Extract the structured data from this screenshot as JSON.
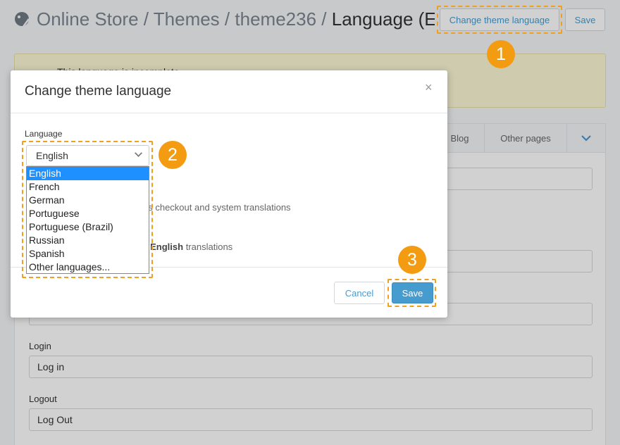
{
  "header": {
    "breadcrumb": [
      "Online Store",
      "Themes",
      "theme236"
    ],
    "separator": "/",
    "current": "Language (En…",
    "change_language_label": "Change theme language",
    "save_label": "Save"
  },
  "warning": {
    "text": "This language is incomplete"
  },
  "tabs": {
    "blog": "Blog",
    "other_pages": "Other pages"
  },
  "fields": [
    {
      "label": "Login",
      "value": "Log in"
    },
    {
      "label": "Logout",
      "value": "Log Out"
    }
  ],
  "modal": {
    "title": "Change theme language",
    "close": "×",
    "language_label": "Language",
    "selected": "English",
    "options": [
      "English",
      "French",
      "German",
      "Portuguese",
      "Portuguese (Brazil)",
      "Russian",
      "Spanish",
      "Other languages..."
    ],
    "option_text_1": "es checkout and system translations",
    "option_text_2_prefix": "s ",
    "option_text_2_bold": "English",
    "option_text_2_suffix": " translations",
    "cancel_label": "Cancel",
    "save_label": "Save"
  },
  "badges": [
    "1",
    "2",
    "3"
  ],
  "colors": {
    "accent": "#479ccf",
    "badge": "#f39c12",
    "highlight": "#1e90ff",
    "warning_bg": "#fcf8d6"
  },
  "icons": {
    "header": "paint-palette-icon",
    "warning": "warning-icon",
    "close": "close-icon",
    "chevron": "chevron-down-icon"
  }
}
